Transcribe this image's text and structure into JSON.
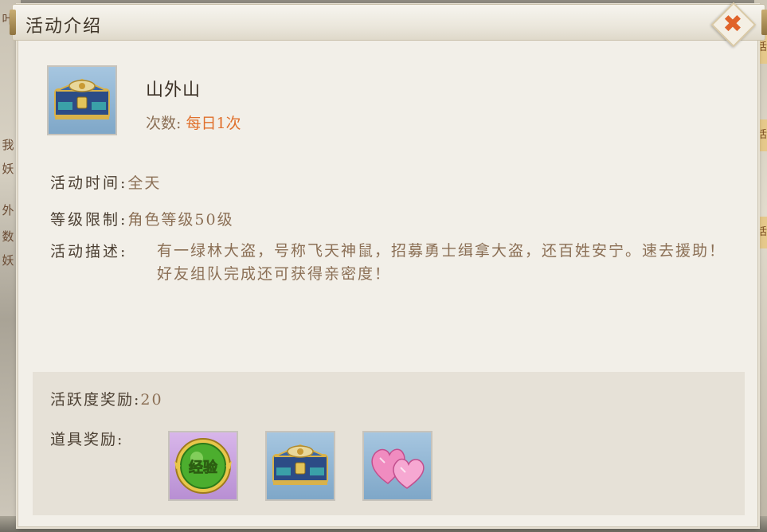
{
  "background": {
    "left_tags": [
      "叶",
      "我",
      "妖",
      "外",
      "数",
      "妖"
    ],
    "right_tags": [
      "活",
      "活",
      "活"
    ]
  },
  "dialog": {
    "title": "活动介绍",
    "close_icon": "close-x-icon"
  },
  "activity": {
    "icon": "treasure-chest-icon",
    "name": "山外山",
    "count_label": "次数:",
    "count_value": "每日1次"
  },
  "info": {
    "time_label": "活动时间:",
    "time_value": "全天",
    "level_label": "等级限制:",
    "level_value": "角色等级50级",
    "desc_label": "活动描述:",
    "desc_value": "有一绿林大盗，号称飞天神鼠，招募勇士缉拿大盗，还百姓安宁。速去援助！好友组队完成还可获得亲密度！"
  },
  "rewards": {
    "activity_label": "活跃度奖励:",
    "activity_value": "20",
    "items_label": "道具奖励:",
    "items": [
      {
        "icon": "exp-orb-icon",
        "text": "经验"
      },
      {
        "icon": "treasure-chest-icon",
        "text": ""
      },
      {
        "icon": "pink-hearts-icon",
        "text": ""
      }
    ]
  },
  "colors": {
    "accent_orange": "#e0702c",
    "label_brown": "#4c4033",
    "value_brown": "#8b6f55",
    "panel_bg": "#f2efe8"
  }
}
